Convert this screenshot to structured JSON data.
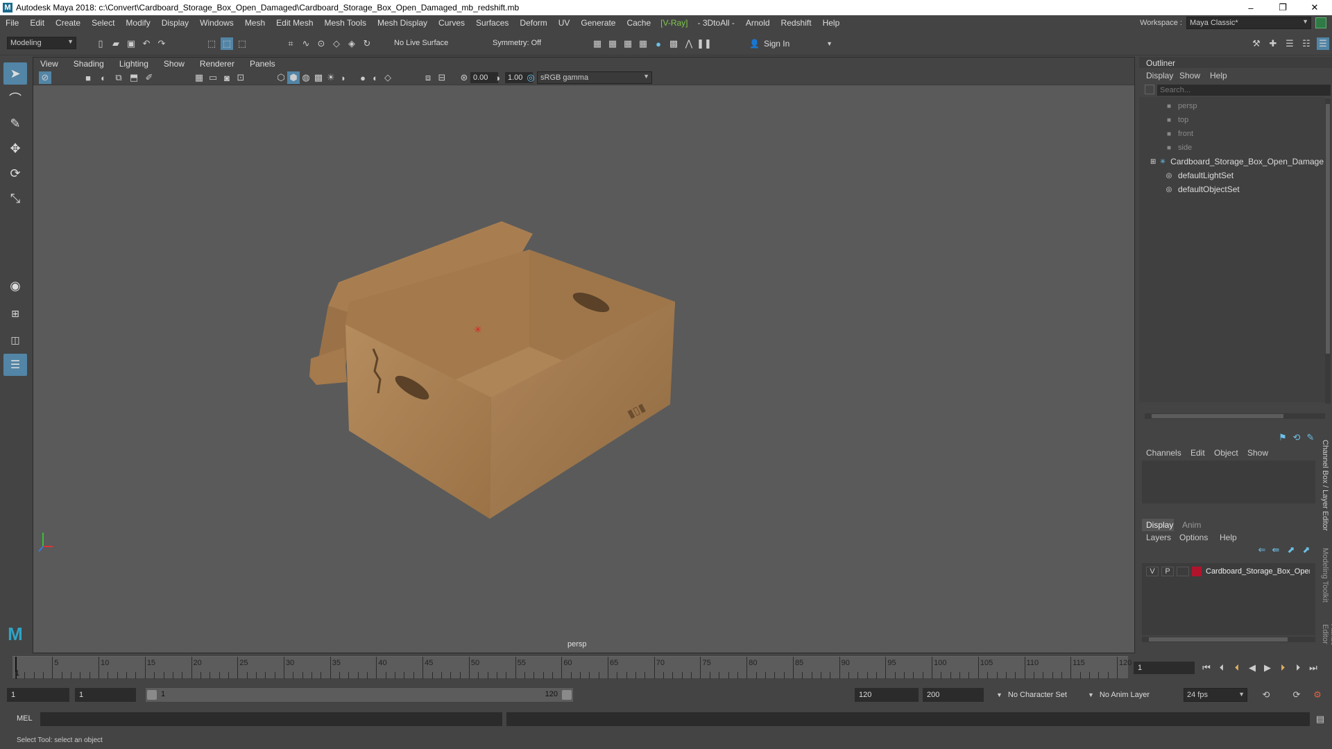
{
  "window": {
    "title": "Autodesk Maya 2018: c:\\Convert\\Cardboard_Storage_Box_Open_Damaged\\Cardboard_Storage_Box_Open_Damaged_mb_redshift.mb",
    "minimize": "–",
    "maximize": "❐",
    "close": "✕"
  },
  "menubar": {
    "items": [
      "File",
      "Edit",
      "Create",
      "Select",
      "Modify",
      "Display",
      "Windows",
      "Mesh",
      "Edit Mesh",
      "Mesh Tools",
      "Mesh Display",
      "Curves",
      "Surfaces",
      "Deform",
      "UV",
      "Generate",
      "Cache",
      "[V-Ray]",
      "- 3DtoAll -",
      "Arnold",
      "Redshift",
      "Help"
    ],
    "workspace_label": "Workspace :",
    "workspace_value": "Maya Classic*"
  },
  "statusline": {
    "mode": "Modeling",
    "live_surface": "No Live Surface",
    "symmetry": "Symmetry: Off",
    "sign_in": "Sign In"
  },
  "viewport": {
    "menu": [
      "View",
      "Shading",
      "Lighting",
      "Show",
      "Renderer",
      "Panels"
    ],
    "exposure": "0.00",
    "gamma": "1.00",
    "color_space": "sRGB gamma",
    "camera_label": "persp"
  },
  "outliner": {
    "title": "Outliner",
    "menu": [
      "Display",
      "Show",
      "Help"
    ],
    "search_placeholder": "Search...",
    "items": [
      {
        "label": "persp",
        "type": "camera",
        "dim": true
      },
      {
        "label": "top",
        "type": "camera",
        "dim": true
      },
      {
        "label": "front",
        "type": "camera",
        "dim": true
      },
      {
        "label": "side",
        "type": "camera",
        "dim": true
      },
      {
        "label": "Cardboard_Storage_Box_Open_Damage",
        "type": "group",
        "dim": false
      },
      {
        "label": "defaultLightSet",
        "type": "set",
        "dim": false
      },
      {
        "label": "defaultObjectSet",
        "type": "set",
        "dim": false
      }
    ]
  },
  "channelbox": {
    "menu": [
      "Channels",
      "Edit",
      "Object",
      "Show"
    ],
    "side_tab_1": "Channel Box / Layer Editor",
    "side_tab_2": "Modeling Toolkit",
    "side_tab_3": "Attribute Editor"
  },
  "layer_editor": {
    "tabs": [
      "Display",
      "Anim"
    ],
    "menu": [
      "Layers",
      "Options",
      "Help"
    ],
    "layer": {
      "v": "V",
      "p": "P",
      "name": "Cardboard_Storage_Box_Oper",
      "color": "#b0142d"
    }
  },
  "timeline": {
    "labels": [
      "5",
      "10",
      "15",
      "20",
      "25",
      "30",
      "35",
      "40",
      "45",
      "50",
      "55",
      "60",
      "65",
      "70",
      "75",
      "80",
      "85",
      "90",
      "95",
      "100",
      "105",
      "110",
      "115",
      "120"
    ],
    "current_frame_marker": "1",
    "current_frame_field": "1"
  },
  "range": {
    "start": "1",
    "playback_start": "1",
    "slider_start": "1",
    "slider_end": "120",
    "playback_end": "120",
    "end": "200",
    "character_set": "No Character Set",
    "anim_layer": "No Anim Layer",
    "fps": "24 fps"
  },
  "cmdline": {
    "label": "MEL"
  },
  "helpline": {
    "text": "Select Tool: select an object"
  }
}
